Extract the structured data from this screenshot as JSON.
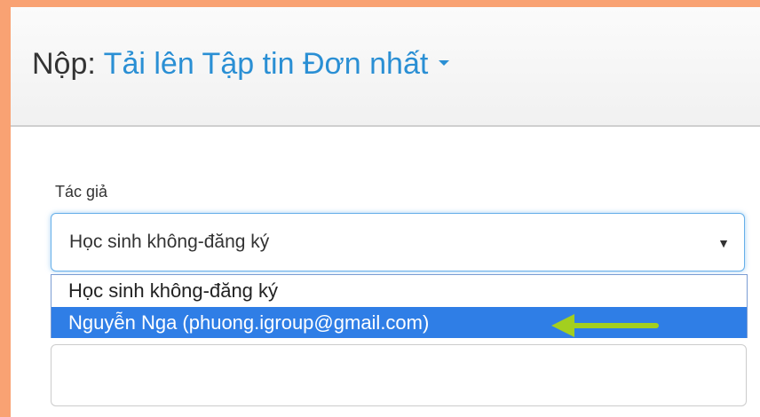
{
  "header": {
    "title_prefix": "Nộp:",
    "title_link": "Tải lên Tập tin Đơn nhất"
  },
  "author": {
    "label": "Tác giả",
    "selected": "Học sinh không-đăng ký",
    "options": [
      "Học sinh không-đăng ký",
      "Nguyễn Nga (phuong.igroup@gmail.com)"
    ]
  },
  "colors": {
    "background_border": "#f9a273",
    "link_blue": "#2a8fd4",
    "highlight": "#2f7ee6",
    "annotation_arrow": "#a3cf1f"
  }
}
